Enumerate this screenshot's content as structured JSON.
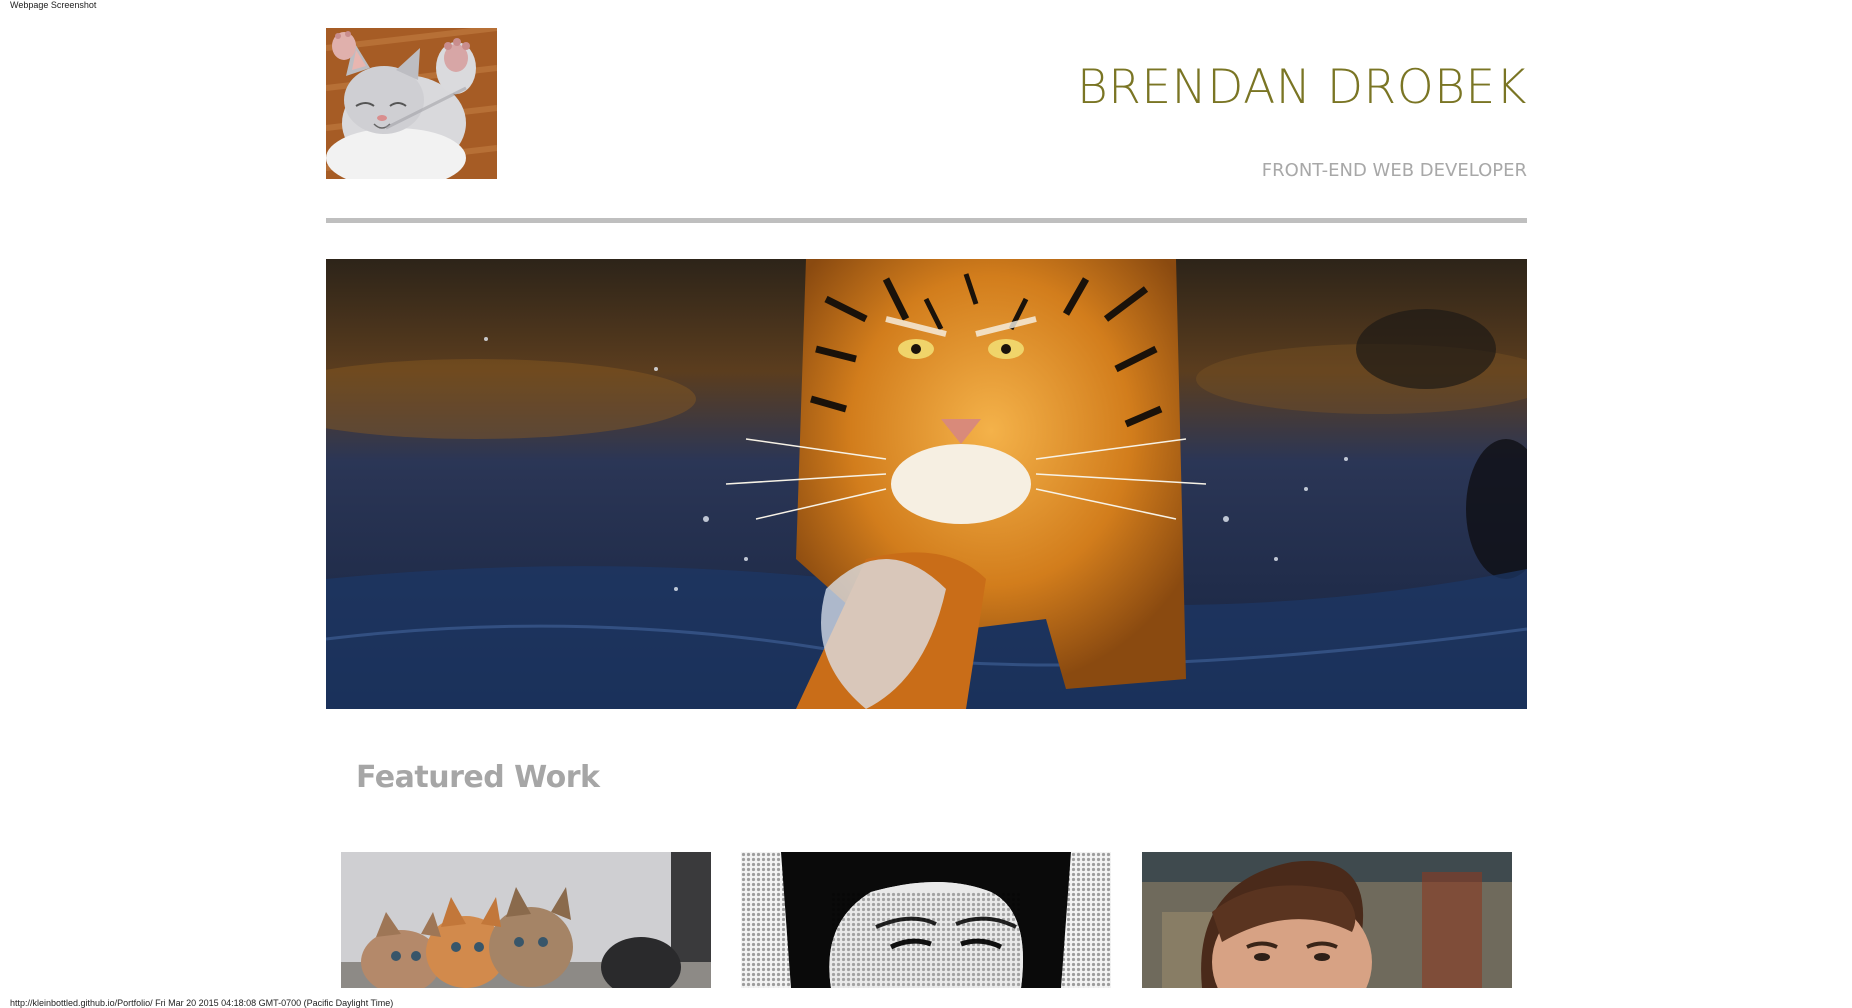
{
  "screenshot": {
    "top_caption": "Webpage Screenshot",
    "bottom_caption": "http://kleinbottled.github.io/Portfolio/ Fri Mar 20 2015 04:18:08 GMT-0700 (Pacific Daylight Time)"
  },
  "header": {
    "name": "BRENDAN DROBEK",
    "role": "FRONT-END WEB DEVELOPER",
    "logo_image": "kitten-logo"
  },
  "hero": {
    "image": "tiger-in-water"
  },
  "featured": {
    "title": "Featured Work",
    "items": [
      {
        "image": "kittens-photo"
      },
      {
        "image": "halftone-portrait"
      },
      {
        "image": "man-portrait"
      }
    ]
  },
  "colors": {
    "name": "#7a7524",
    "muted": "#a8a8a8",
    "divider": "#bfbfbf"
  }
}
